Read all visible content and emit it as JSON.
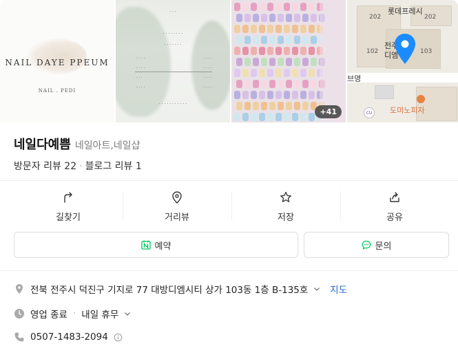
{
  "photos": {
    "photo1": {
      "logo_text": "NAIL DAYE PPEUM",
      "logo_subtext": "NAIL . PEDI"
    },
    "more_count": "+41"
  },
  "map": {
    "labels": {
      "lotte": "롯데프레시",
      "n202a": "202",
      "n202b": "202",
      "n102": "102",
      "n103": "103",
      "jeon": "전주",
      "dibang": "디엠",
      "bu_yeong": "브영",
      "domino": "도미노피자",
      "cu": "CU"
    }
  },
  "place": {
    "name": "네일다예쁨",
    "category": "네일아트,네일샵",
    "visitor_reviews": "방문자 리뷰 22",
    "blog_reviews": "블로그 리뷰 1"
  },
  "actions": [
    {
      "label": "길찾기",
      "icon": "directions-icon"
    },
    {
      "label": "거리뷰",
      "icon": "map-pin-outline-icon"
    },
    {
      "label": "저장",
      "icon": "star-icon"
    },
    {
      "label": "공유",
      "icon": "share-icon"
    }
  ],
  "buttons": {
    "reserve": "예약",
    "inquiry": "문의"
  },
  "info": {
    "address": "전북 전주시 덕진구 기지로 77 대방디엠시티 상가 103동 1층 B-135호",
    "map_link": "지도",
    "status": "영업 종료",
    "status_next": "내일 휴무",
    "phone": "0507-1483-2094"
  },
  "colors": {
    "pin": "#1a8cff",
    "link": "#1e62d0",
    "naver_green": "#03c75a"
  }
}
